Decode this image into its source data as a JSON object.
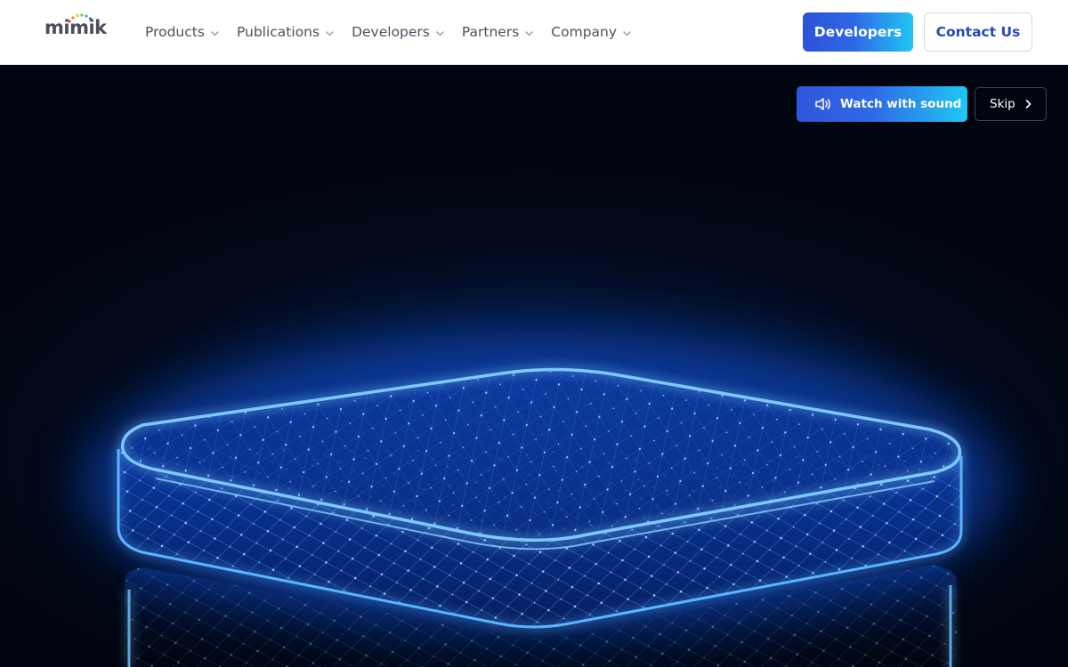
{
  "brand": {
    "logo_text": "mimik"
  },
  "nav": {
    "items": [
      {
        "label": "Products"
      },
      {
        "label": "Publications"
      },
      {
        "label": "Developers"
      },
      {
        "label": "Partners"
      },
      {
        "label": "Company"
      }
    ]
  },
  "header_actions": {
    "developers_label": "Developers",
    "contact_label": "Contact Us"
  },
  "hero": {
    "watch_label": "Watch with sound",
    "skip_label": "Skip"
  },
  "colors": {
    "accent_blue": "#2c52d8",
    "accent_cyan": "#22c6f2",
    "nav_text": "#4b5260",
    "hero_bg": "#020a1c",
    "glow": "#3aa8ff"
  },
  "icons": [
    "chevron-down-icon",
    "speaker-icon",
    "chevron-right-icon"
  ]
}
